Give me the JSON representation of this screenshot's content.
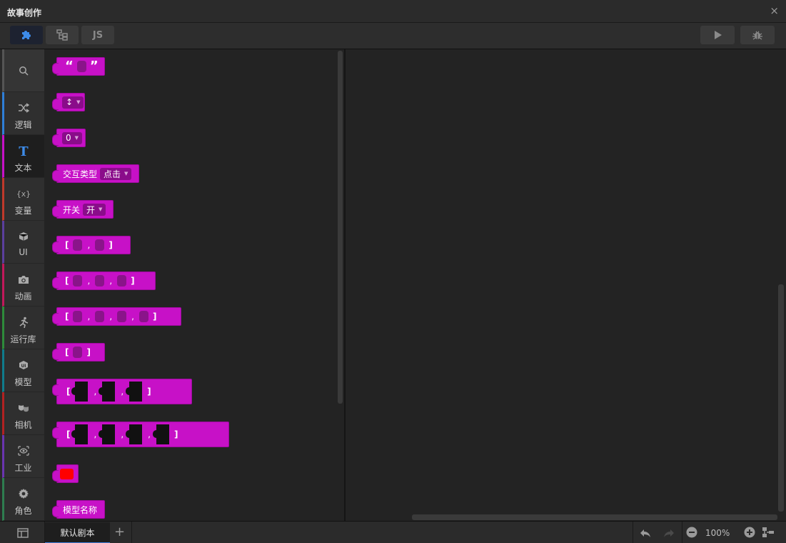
{
  "window": {
    "title": "故事创作",
    "close_glyph": "×"
  },
  "toolbar": {
    "tabs": [
      {
        "name": "blocks",
        "icon": "puzzle-icon"
      },
      {
        "name": "structure",
        "icon": "hierarchy-icon"
      },
      {
        "name": "javascript",
        "label": "JS"
      }
    ],
    "actions": [
      {
        "icon": "play-icon"
      },
      {
        "icon": "bug-icon"
      }
    ]
  },
  "categories": [
    {
      "label": "",
      "icon": "search-icon"
    },
    {
      "label": "逻辑",
      "icon": "shuffle-icon",
      "color": "#2f7fd8"
    },
    {
      "label": "文本",
      "icon": "text-icon",
      "color": "#c711c7"
    },
    {
      "label": "变量",
      "icon": "variable-icon",
      "color": "#c0392b"
    },
    {
      "label": "UI",
      "icon": "cube-icon",
      "color": "#5b3f9e"
    },
    {
      "label": "动画",
      "icon": "camera-icon",
      "color": "#c2185b"
    },
    {
      "label": "运行库",
      "icon": "runner-icon",
      "color": "#2e8b3a"
    },
    {
      "label": "模型",
      "icon": "model-icon",
      "color": "#0f7c8c"
    },
    {
      "label": "相机",
      "icon": "mask-icon",
      "color": "#b22222"
    },
    {
      "label": "工业",
      "icon": "eye-icon",
      "color": "#6a35b0"
    },
    {
      "label": "角色",
      "icon": "gear-icon",
      "color": "#2e7d4f"
    }
  ],
  "blocks": {
    "quote_open": "“",
    "quote_close": "”",
    "arrow_dropdown": "↕",
    "number_dropdown": "0",
    "interaction_label": "交互类型",
    "interaction_value": "点击",
    "switch_label": "开关",
    "switch_value": "开",
    "bracket_open": "[",
    "bracket_close": "]",
    "comma": ",",
    "color_value": "#ff0000",
    "model_name": "模型名称"
  },
  "bottombar": {
    "tab_label": "默认剧本",
    "add_glyph": "+",
    "zoom": "100%"
  }
}
